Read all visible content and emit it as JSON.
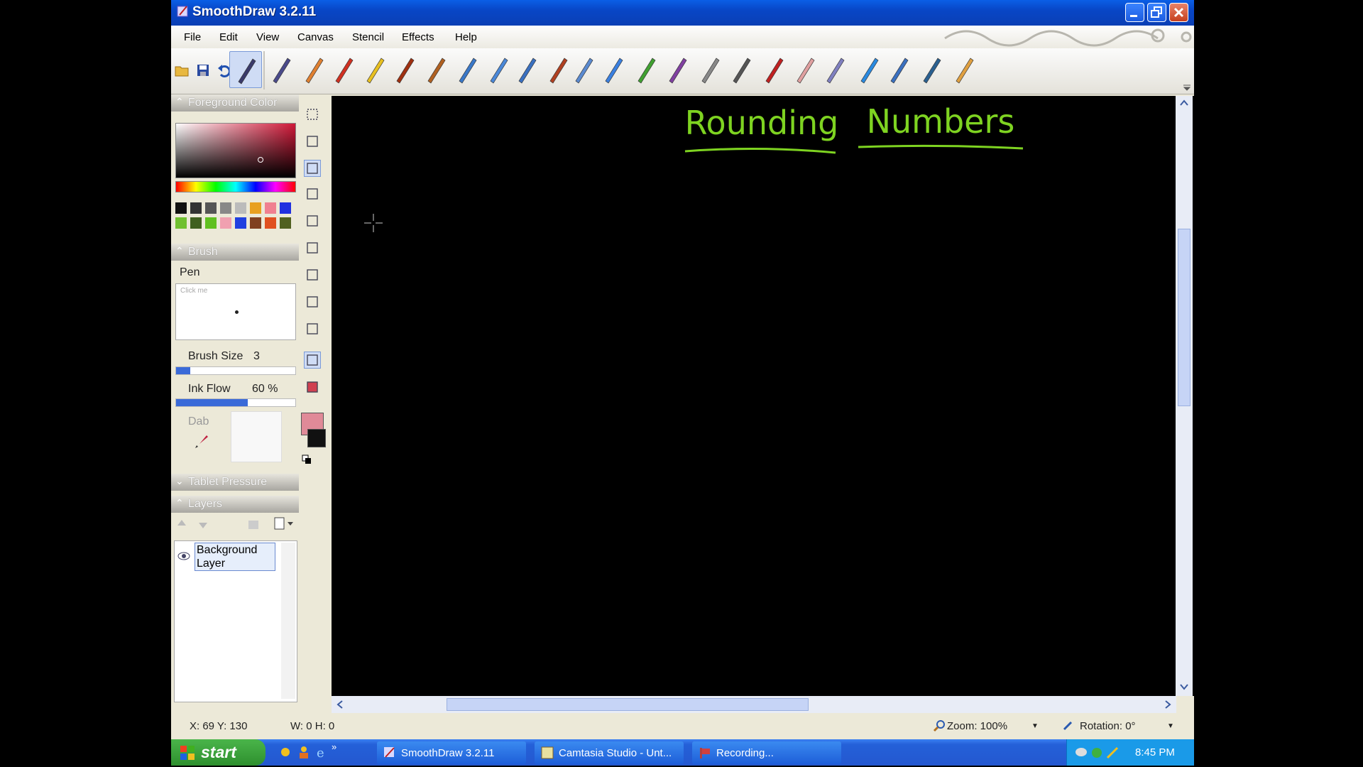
{
  "window": {
    "title": "SmoothDraw 3.2.11"
  },
  "menu": [
    "File",
    "Edit",
    "View",
    "Canvas",
    "Stencil",
    "Effects",
    "Help"
  ],
  "panels": {
    "foreground_color": "Foreground Color",
    "brush": "Brush",
    "brush_name": "Pen",
    "preview_hint": "Click me",
    "brush_size_label": "Brush Size",
    "brush_size_value": "3",
    "brush_size_fraction": 0.12,
    "ink_flow_label": "Ink Flow",
    "ink_flow_value": "60 %",
    "ink_flow_fraction": 0.6,
    "dab_label": "Dab",
    "tablet_pressure": "Tablet Pressure",
    "layers": "Layers",
    "layer_name": "Background\nLayer"
  },
  "colors": {
    "selected_foreground": "#b01a3a",
    "primary": "#e08a98",
    "secondary": "#111111",
    "palette_row1": [
      "#111111",
      "#333333",
      "#555555",
      "#888888",
      "#bbbbbb",
      "#e8a020",
      "#f08090",
      "#2030e0"
    ],
    "palette_row2": [
      "#70c030",
      "#406020",
      "#60c020",
      "#f0a0b0",
      "#2040e0",
      "#804020",
      "#e05020",
      "#506020"
    ],
    "canvas_text": "#7ed321"
  },
  "canvas": {
    "heading_word1": "Rounding",
    "heading_word2": "Numbers"
  },
  "status": {
    "coords": "X: 69 Y: 130",
    "size": "W: 0 H: 0",
    "zoom": "Zoom: 100%",
    "rotation": "Rotation: 0°"
  },
  "taskbar": {
    "start": "start",
    "tasks": [
      "SmoothDraw 3.2.11",
      "Camtasia Studio - Unt...",
      "Recording..."
    ],
    "time": "8:45 PM"
  },
  "icons": {
    "toolbar_file": [
      "open-folder-icon",
      "save-icon",
      "undo-icon",
      "redo-icon"
    ],
    "brushes": [
      "pen-icon",
      "pencil-icon",
      "crayon-icon",
      "marker-icon",
      "highlighter-icon",
      "paintbrush-icon",
      "flat-brush-icon",
      "airbrush-icon",
      "spray-icon",
      "detail-airbrush-icon",
      "smudge-icon",
      "watercolor-icon",
      "blur-icon",
      "grass-icon",
      "flower-icon",
      "texture-icon",
      "rock-icon",
      "stamp-icon",
      "eraser-icon",
      "hard-eraser-icon",
      "water-drop-icon",
      "image-layer-icon",
      "image-stamp-icon",
      "finger-icon"
    ],
    "tools": [
      "select-rect-icon",
      "move-icon",
      "brush-tool-icon",
      "eraser-tool-icon",
      "fill-icon",
      "bucket-icon",
      "text-icon",
      "eyedropper-icon",
      "hand-icon",
      "rectangle-icon",
      "record-icon"
    ]
  }
}
